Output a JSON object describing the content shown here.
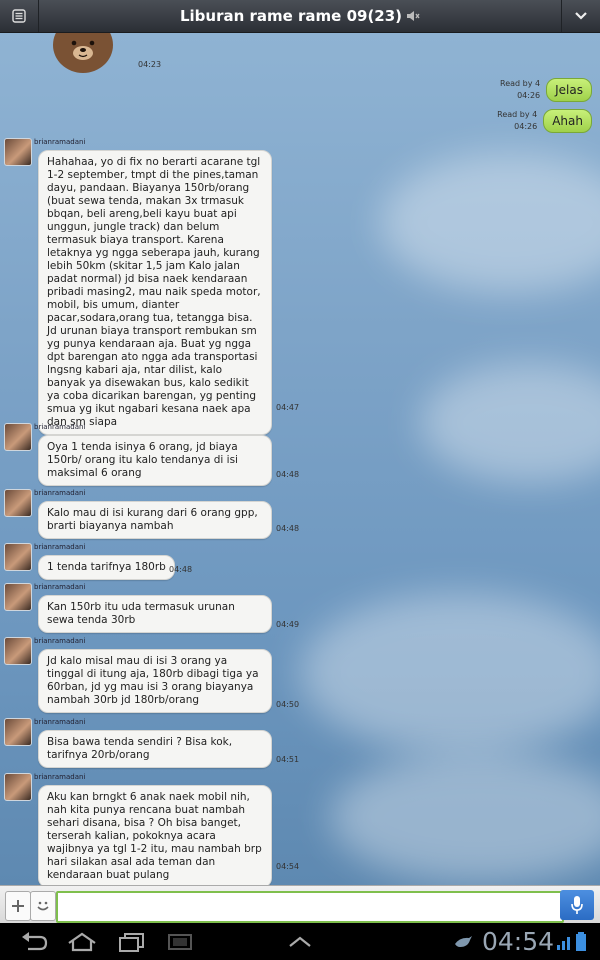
{
  "header": {
    "title": "Liburan rame rame 09(23)"
  },
  "sticker": {
    "time": "04:23"
  },
  "sent": [
    {
      "read": "Read by 4",
      "time": "04:26",
      "text": "Jelas"
    },
    {
      "read": "Read by 4",
      "time": "04:26",
      "text": "Ahah"
    }
  ],
  "messages": [
    {
      "sender": "brianramadani",
      "time": "04:47",
      "text": "Hahahaa, yo di fix no berarti acarane tgl 1-2 september, tmpt di the pines,taman dayu, pandaan. Biayanya 150rb/orang (buat sewa tenda, makan 3x trmasuk bbqan, beli areng,beli kayu buat api unggun, jungle track) dan belum termasuk biaya transport. Karena letaknya yg ngga seberapa jauh, kurang lebih 50km (skitar 1,5 jam Kalo jalan padat normal) jd bisa naek kendaraan pribadi masing2, mau naik speda motor, mobil, bis umum, dianter pacar,sodara,orang tua, tetangga bisa. Jd urunan biaya transport rembukan sm yg punya kendaraan aja. Buat yg ngga dpt barengan ato ngga ada transportasi lngsng kabari aja, ntar dilist, kalo banyak ya disewakan bus, kalo sedikit ya coba dicarikan barengan, yg penting smua yg ikut ngabari kesana naek apa dan sm siapa"
    },
    {
      "sender": "brianramadani",
      "time": "04:48",
      "text": "Oya 1 tenda isinya 6 orang, jd biaya 150rb/ orang itu kalo tendanya di isi maksimal 6 orang"
    },
    {
      "sender": "brianramadani",
      "time": "04:48",
      "text": "Kalo mau di isi kurang dari 6 orang gpp, brarti biayanya nambah"
    },
    {
      "sender": "brianramadani",
      "time": "04:48",
      "text": "1 tenda tarifnya 180rb"
    },
    {
      "sender": "brianramadani",
      "time": "04:49",
      "text": "Kan 150rb itu uda termasuk urunan sewa tenda 30rb"
    },
    {
      "sender": "brianramadani",
      "time": "04:50",
      "text": "Jd kalo misal mau di isi 3 orang ya tinggal di itung aja, 180rb dibagi tiga ya 60rban, jd yg mau isi 3 orang biayanya nambah 30rb jd 180rb/orang"
    },
    {
      "sender": "brianramadani",
      "time": "04:51",
      "text": "Bisa bawa tenda sendiri ? Bisa kok, tarifnya 20rb/orang"
    },
    {
      "sender": "brianramadani",
      "time": "04:54",
      "text": "Aku kan brngkt 6 anak naek mobil nih, nah kita punya rencana buat nambah sehari disana, bisa ? Oh bisa banget, terserah kalian, pokoknya acara wajibnya ya tgl 1-2 itu, mau nambah brp hari silakan asal ada teman dan kendaraan buat pulang"
    }
  ],
  "input": {
    "placeholder": ""
  },
  "system": {
    "clock": "04:54"
  }
}
